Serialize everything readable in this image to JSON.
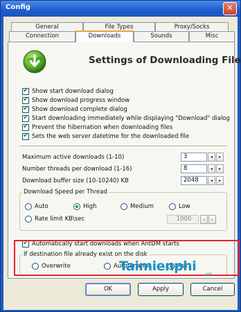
{
  "window": {
    "title": "Config",
    "close_glyph": "✕"
  },
  "tabs_row1": [
    {
      "label": "General"
    },
    {
      "label": "File Types"
    },
    {
      "label": "Proxy/Socks"
    }
  ],
  "tabs_row2": [
    {
      "label": "Connection"
    },
    {
      "label": "Downloads",
      "active": true
    },
    {
      "label": "Sounds"
    },
    {
      "label": "Misc"
    }
  ],
  "header": {
    "title": "Settings of Downloading Files",
    "icon": "download-globe-icon"
  },
  "options": [
    {
      "label": "Show start download dialog",
      "checked": true
    },
    {
      "label": "Show download progress window",
      "checked": true
    },
    {
      "label": "Show download complete dialog",
      "checked": true
    },
    {
      "label": "Start downloading immediately while displaying \"Download\" dialog",
      "checked": true
    },
    {
      "label": "Prevent the hibernation when downloading files",
      "checked": true
    },
    {
      "label": "Sets the web server datetime for the downloaded file",
      "checked": true
    }
  ],
  "fields": [
    {
      "label": "Maximum active downloads (1-10)",
      "value": "3"
    },
    {
      "label": "Number threads per download (1-16)",
      "value": "8"
    },
    {
      "label": "Download buffer size (10-10240) KB",
      "value": "2048"
    }
  ],
  "speed_group": {
    "label": "Download Speed per Thread",
    "options": [
      {
        "label": "Auto",
        "selected": false
      },
      {
        "label": "High",
        "selected": true
      },
      {
        "label": "Medium",
        "selected": false
      },
      {
        "label": "Low",
        "selected": false
      },
      {
        "label": "Rate limit KB\\sec",
        "selected": false
      }
    ],
    "rate_value": "1000"
  },
  "auto_start": {
    "label": "Automatically start downloads when AntDM starts",
    "checked": true
  },
  "exist_group": {
    "label": "If destination file already exist on the disk",
    "options": [
      {
        "label": "Overwrite",
        "selected": false
      },
      {
        "label": "Autorename",
        "selected": false
      },
      {
        "label": "Ask",
        "selected": true
      }
    ]
  },
  "buttons": {
    "ok": "OK",
    "apply": "Apply",
    "cancel": "Cancel"
  },
  "spin_glyphs": {
    "left": "◂",
    "right": "▸"
  },
  "watermark": {
    "text": "Taimienphi",
    "suffix": ".vn"
  },
  "colors": {
    "highlight": "#e8212b",
    "titlebar": "#1f5fd0",
    "watermark": "#1a93c9"
  }
}
